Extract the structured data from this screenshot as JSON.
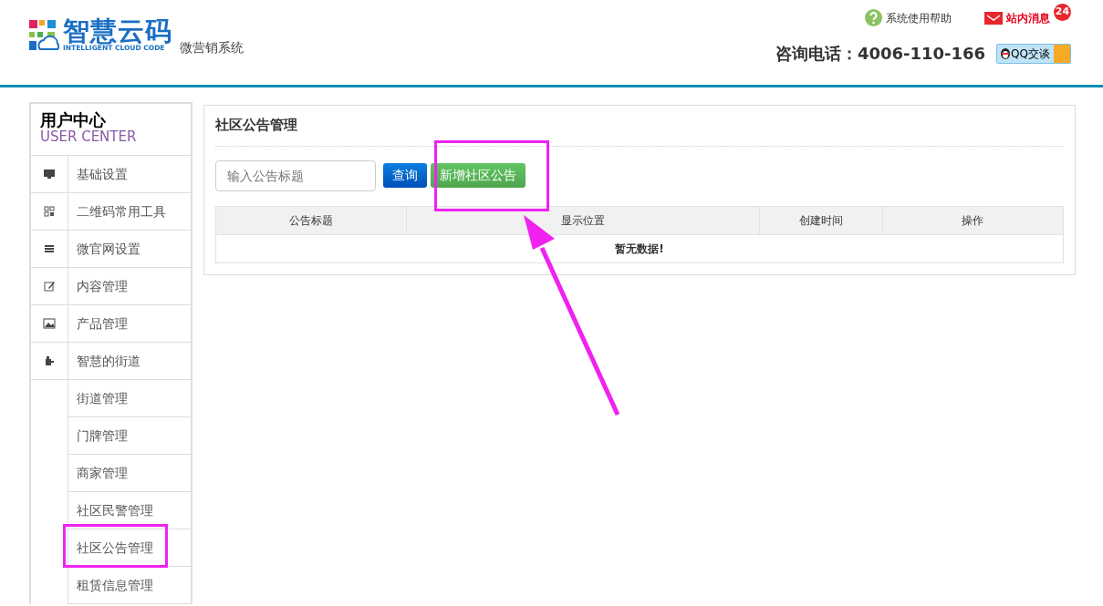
{
  "header": {
    "logo_title": "智慧云码",
    "logo_subtitle": "INTELLIGENT CLOUD CODE",
    "system_name": "微营销系统",
    "help_link": "系统使用帮助",
    "messages_link": "站内消息",
    "messages_count": "24",
    "hotline": "咨询电话：4006-110-166",
    "qq_button": "QQ交谈"
  },
  "sidebar": {
    "title": "用户中心",
    "subtitle": "USER CENTER",
    "items": [
      {
        "label": "基础设置",
        "kind": "monitor"
      },
      {
        "label": "二维码常用工具",
        "kind": "qr"
      },
      {
        "label": "微官网设置",
        "kind": "menu"
      },
      {
        "label": "内容管理",
        "kind": "edit"
      },
      {
        "label": "产品管理",
        "kind": "image"
      },
      {
        "label": "智慧的街道",
        "kind": "puzzle",
        "expanded": true,
        "children": [
          {
            "label": "街道管理"
          },
          {
            "label": "门牌管理"
          },
          {
            "label": "商家管理"
          },
          {
            "label": "社区民警管理"
          },
          {
            "label": "社区公告管理"
          },
          {
            "label": "租赁信息管理"
          }
        ]
      }
    ]
  },
  "main": {
    "title": "社区公告管理",
    "search": {
      "placeholder": "输入公告标题"
    },
    "buttons": [
      {
        "label": "查询",
        "kind": "primary"
      },
      {
        "label": "新增社区公告",
        "kind": "success"
      }
    ],
    "table": {
      "columns": [
        "公告标题",
        "显示位置",
        "创建时间",
        "操作"
      ],
      "empty_message": "暂无数据!"
    }
  }
}
